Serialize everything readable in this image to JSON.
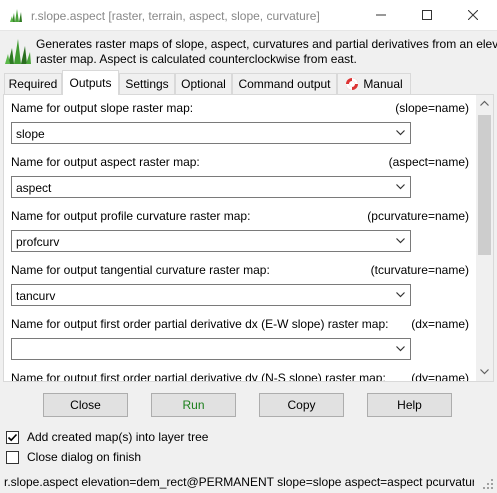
{
  "window": {
    "title": "r.slope.aspect [raster, terrain, aspect, slope, curvature]",
    "app_icon": "grass-icon",
    "controls": [
      "minimize-icon",
      "maximize-icon",
      "close-icon"
    ]
  },
  "header": {
    "description_line1": "Generates raster maps of slope, aspect, curvatures and partial derivatives from an elevat",
    "description_line2": "raster map. Aspect is calculated counterclockwise from east."
  },
  "tabs": [
    {
      "label": "Required"
    },
    {
      "label": "Outputs",
      "active": true
    },
    {
      "label": "Settings"
    },
    {
      "label": "Optional"
    },
    {
      "label": "Command output"
    },
    {
      "label": "Manual",
      "icon": "lifebuoy-icon"
    }
  ],
  "outputs": [
    {
      "label": "Name for output slope raster map:",
      "key": "(slope=name)",
      "value": "slope"
    },
    {
      "label": "Name for output aspect raster map:",
      "key": "(aspect=name)",
      "value": "aspect"
    },
    {
      "label": "Name for output profile curvature raster map:",
      "key": "(pcurvature=name)",
      "value": "profcurv"
    },
    {
      "label": "Name for output tangential curvature raster map:",
      "key": "(tcurvature=name)",
      "value": "tancurv"
    },
    {
      "label": "Name for output first order partial derivative dx (E-W slope) raster  map:",
      "key": "(dx=name)",
      "value": ""
    },
    {
      "label": "Name for output first order partial derivative dy (N-S slope) raster  map:",
      "key": "(dy=name)",
      "value": ""
    }
  ],
  "buttons": {
    "close": "Close",
    "run": "Run",
    "copy": "Copy",
    "help": "Help"
  },
  "checkboxes": [
    {
      "label": "Add created map(s) into layer tree",
      "checked": true
    },
    {
      "label": "Close dialog on finish",
      "checked": false
    }
  ],
  "statusbar": {
    "command": "r.slope.aspect elevation=dem_rect@PERMANENT slope=slope aspect=aspect pcurvatur..."
  },
  "colors": {
    "run_text": "#1a7f1a",
    "active_tab": "#ffffff",
    "window_bg": "#f0f0f0"
  }
}
